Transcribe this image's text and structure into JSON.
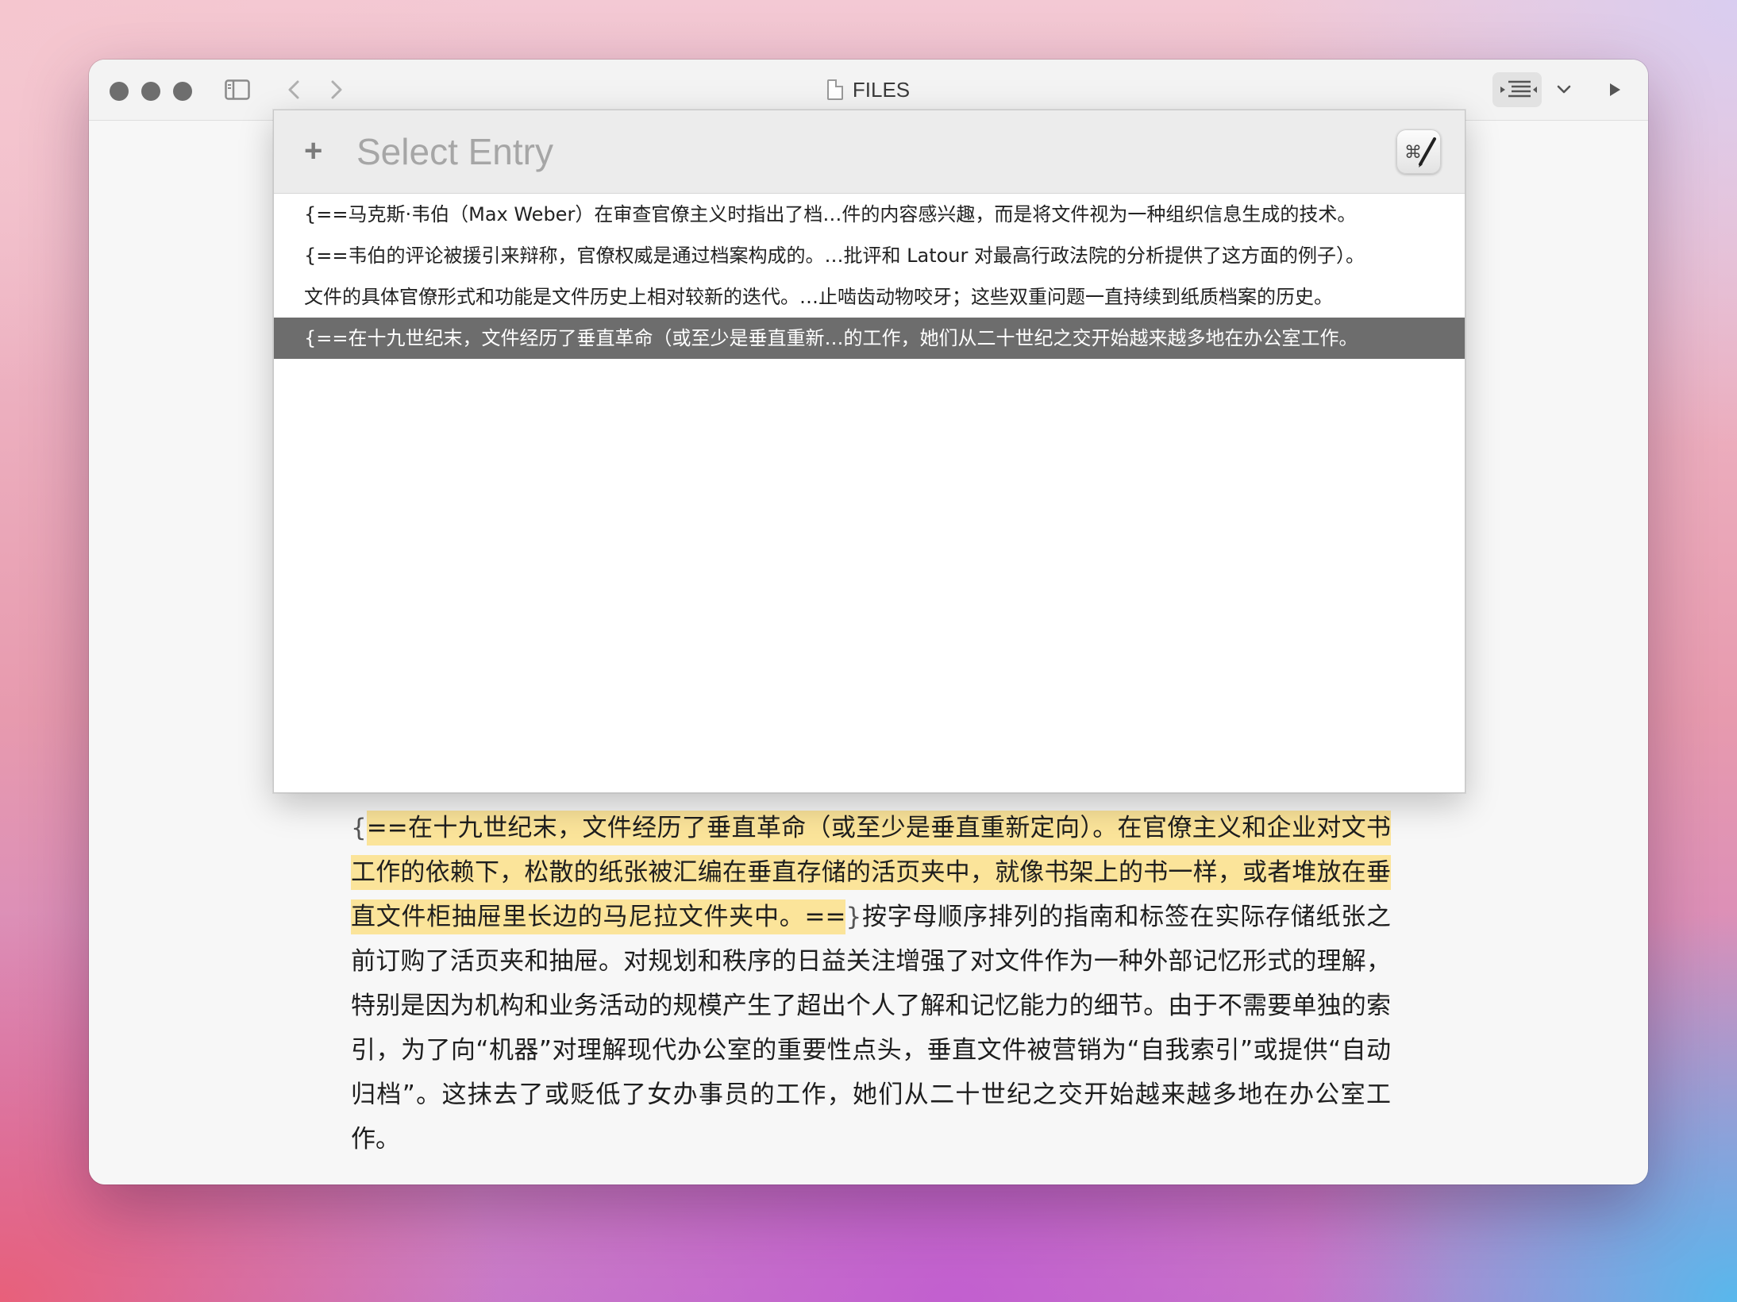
{
  "window": {
    "title": "FILES"
  },
  "popup": {
    "add_label": "+",
    "placeholder": "Select Entry",
    "app_icon": "command-pen-icon",
    "app_glyph": "⌘",
    "results": [
      {
        "text": "{==马克斯·韦伯（Max Weber）在审查官僚主义时指出了档…件的内容感兴趣，而是将文件视为一种组织信息生成的技术。",
        "selected": false
      },
      {
        "text": "{==韦伯的评论被援引来辩称，官僚权威是通过档案构成的。…批评和 Latour 对最高行政法院的分析提供了这方面的例子）。",
        "selected": false
      },
      {
        "text": "文件的具体官僚形式和功能是文件历史上相对较新的迭代。…止啮齿动物咬牙；这些双重问题一直持续到纸质档案的历史。",
        "selected": false
      },
      {
        "text": "{==在十九世纪末，文件经历了垂直革命（或至少是垂直重新…的工作，她们从二十世纪之交开始越来越多地在办公室工作。",
        "selected": true
      }
    ]
  },
  "document": {
    "open_delim": "{",
    "highlight_text": "==在十九世纪末，文件经历了垂直革命（或至少是垂直重新定向）。在官僚主义和企业对文书工作的依赖下，松散的纸张被汇编在垂直存储的活页夹中，就像书架上的书一样，或者堆放在垂直文件柜抽屉里长边的马尼拉文件夹中。==",
    "close_delim": "}",
    "rest_text": "按字母顺序排列的指南和标签在实际存储纸张之前订购了活页夹和抽屉。对规划和秩序的日益关注增强了对文件作为一种外部记忆形式的理解，特别是因为机构和业务活动的规模产生了超出个人了解和记忆能力的细节。由于不需要单独的索引，为了向“机器”对理解现代办公室的重要性点头，垂直文件被营销为“自我索引”或提供“自动归档”。这抹去了或贬低了女办事员的工作，她们从二十世纪之交开始越来越多地在办公室工作。"
  },
  "colors": {
    "highlight": "#fbe49a",
    "selected_row": "#6d6d6d",
    "traffic_light": "#6e6e6e"
  }
}
